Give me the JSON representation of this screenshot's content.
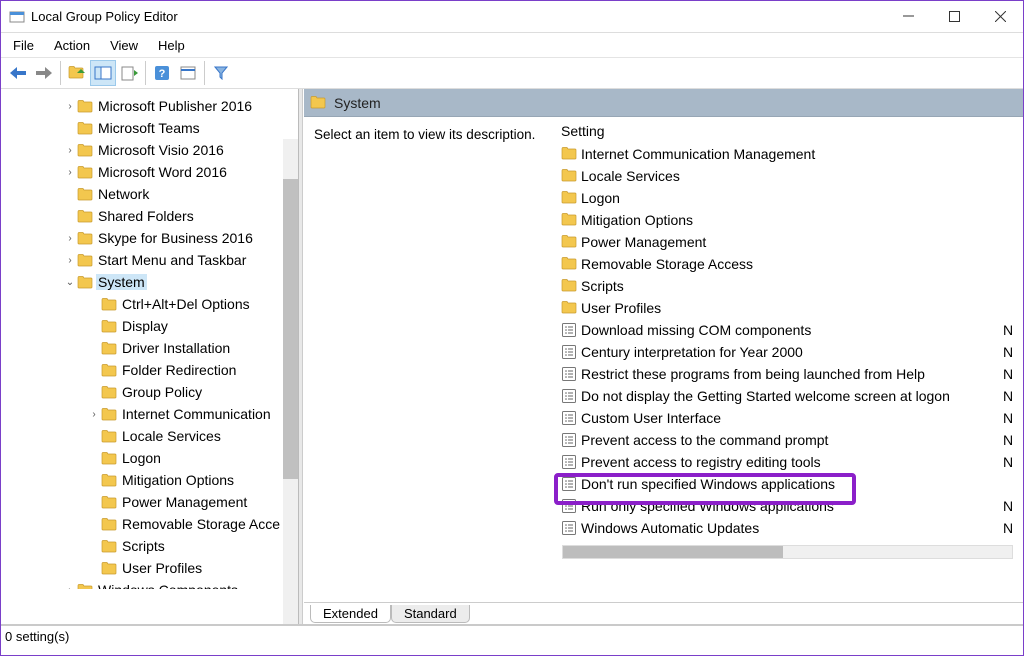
{
  "window": {
    "title": "Local Group Policy Editor"
  },
  "menubar": [
    "File",
    "Action",
    "View",
    "Help"
  ],
  "tree": {
    "items": [
      {
        "indent": 62,
        "expander": "›",
        "label": "Microsoft Publisher 2016"
      },
      {
        "indent": 62,
        "expander": "",
        "label": "Microsoft Teams"
      },
      {
        "indent": 62,
        "expander": "›",
        "label": "Microsoft Visio 2016"
      },
      {
        "indent": 62,
        "expander": "›",
        "label": "Microsoft Word 2016"
      },
      {
        "indent": 62,
        "expander": "",
        "label": "Network"
      },
      {
        "indent": 62,
        "expander": "",
        "label": "Shared Folders"
      },
      {
        "indent": 62,
        "expander": "›",
        "label": "Skype for Business 2016"
      },
      {
        "indent": 62,
        "expander": "›",
        "label": "Start Menu and Taskbar"
      },
      {
        "indent": 62,
        "expander": "⌄",
        "label": "System",
        "selected": true
      },
      {
        "indent": 86,
        "expander": "",
        "label": "Ctrl+Alt+Del Options"
      },
      {
        "indent": 86,
        "expander": "",
        "label": "Display"
      },
      {
        "indent": 86,
        "expander": "",
        "label": "Driver Installation"
      },
      {
        "indent": 86,
        "expander": "",
        "label": "Folder Redirection"
      },
      {
        "indent": 86,
        "expander": "",
        "label": "Group Policy"
      },
      {
        "indent": 86,
        "expander": "›",
        "label": "Internet Communication"
      },
      {
        "indent": 86,
        "expander": "",
        "label": "Locale Services"
      },
      {
        "indent": 86,
        "expander": "",
        "label": "Logon"
      },
      {
        "indent": 86,
        "expander": "",
        "label": "Mitigation Options"
      },
      {
        "indent": 86,
        "expander": "",
        "label": "Power Management"
      },
      {
        "indent": 86,
        "expander": "",
        "label": "Removable Storage Acce"
      },
      {
        "indent": 86,
        "expander": "",
        "label": "Scripts"
      },
      {
        "indent": 86,
        "expander": "",
        "label": "User Profiles"
      },
      {
        "indent": 62,
        "expander": "›",
        "label": "Windows Components"
      }
    ]
  },
  "details": {
    "heading": "System",
    "description": "Select an item to view its description.",
    "column_header": "Setting",
    "rows": [
      {
        "type": "folder",
        "name": "Internet Communication Management",
        "state": ""
      },
      {
        "type": "folder",
        "name": "Locale Services",
        "state": ""
      },
      {
        "type": "folder",
        "name": "Logon",
        "state": ""
      },
      {
        "type": "folder",
        "name": "Mitigation Options",
        "state": ""
      },
      {
        "type": "folder",
        "name": "Power Management",
        "state": ""
      },
      {
        "type": "folder",
        "name": "Removable Storage Access",
        "state": ""
      },
      {
        "type": "folder",
        "name": "Scripts",
        "state": ""
      },
      {
        "type": "folder",
        "name": "User Profiles",
        "state": ""
      },
      {
        "type": "setting",
        "name": "Download missing COM components",
        "state": "N"
      },
      {
        "type": "setting",
        "name": "Century interpretation for Year 2000",
        "state": "N"
      },
      {
        "type": "setting",
        "name": "Restrict these programs from being launched from Help",
        "state": "N"
      },
      {
        "type": "setting",
        "name": "Do not display the Getting Started welcome screen at logon",
        "state": "N"
      },
      {
        "type": "setting",
        "name": "Custom User Interface",
        "state": "N"
      },
      {
        "type": "setting",
        "name": "Prevent access to the command prompt",
        "state": "N"
      },
      {
        "type": "setting",
        "name": "Prevent access to registry editing tools",
        "state": "N"
      },
      {
        "type": "setting",
        "name": "Don't run specified Windows applications",
        "state": "",
        "highlighted": true
      },
      {
        "type": "setting",
        "name": "Run only specified Windows applications",
        "state": "N"
      },
      {
        "type": "setting",
        "name": "Windows Automatic Updates",
        "state": "N"
      }
    ]
  },
  "tabs": {
    "extended": "Extended",
    "standard": "Standard"
  },
  "statusbar": "0 setting(s)"
}
